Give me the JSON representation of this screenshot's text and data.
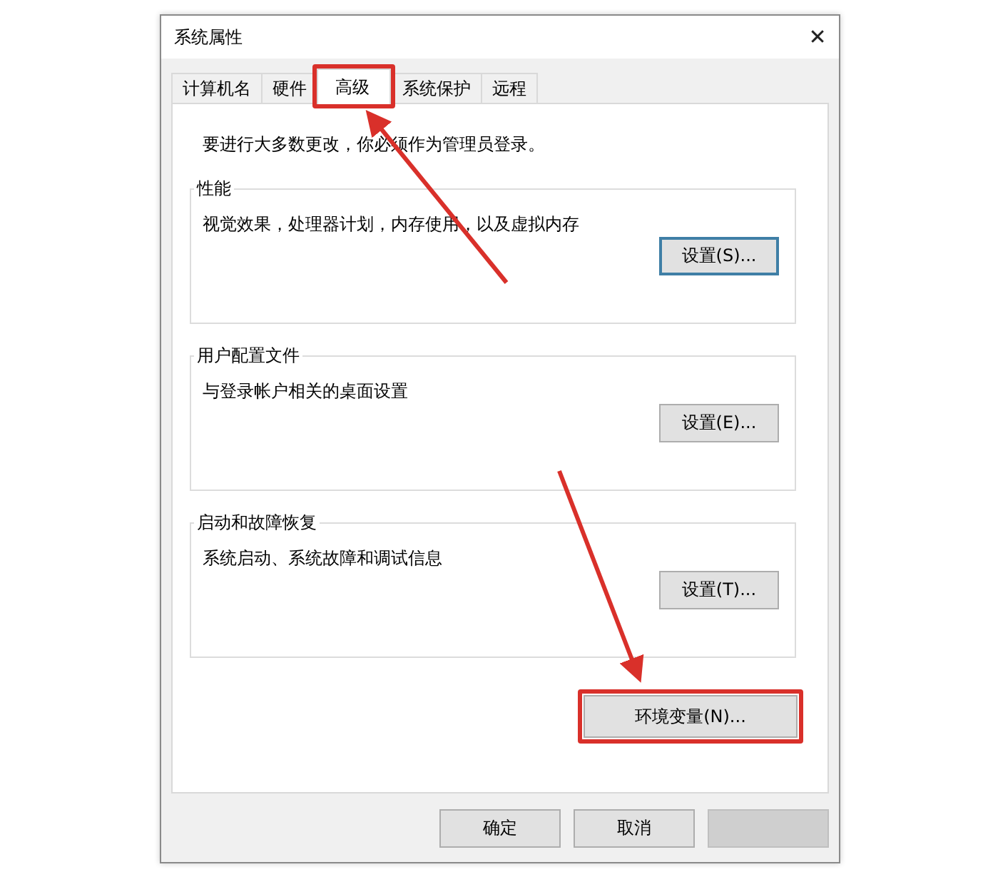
{
  "window": {
    "title": "系统属性",
    "close": "✕"
  },
  "tabs": [
    {
      "label": "计算机名",
      "selected": false
    },
    {
      "label": "硬件",
      "selected": false
    },
    {
      "label": "高级",
      "selected": true,
      "annotated": true
    },
    {
      "label": "系统保护",
      "selected": false
    },
    {
      "label": "远程",
      "selected": false
    }
  ],
  "notice": "要进行大多数更改，你必须作为管理员登录。",
  "groups": [
    {
      "heading": "性能",
      "description": "视觉效果，处理器计划，内存使用，以及虚拟内存",
      "button": {
        "label": "设置(S)...",
        "focused": true
      }
    },
    {
      "heading": "用户配置文件",
      "description": "与登录帐户相关的桌面设置",
      "button": {
        "label": "设置(E)...",
        "focused": false
      }
    },
    {
      "heading": "启动和故障恢复",
      "description": "系统启动、系统故障和调试信息",
      "button": {
        "label": "设置(T)...",
        "focused": false
      }
    }
  ],
  "environment_button": {
    "label": "环境变量(N)...",
    "annotated": true
  },
  "dialog_buttons": [
    {
      "label": "确定",
      "disabled": false
    },
    {
      "label": "取消",
      "disabled": false
    },
    {
      "disabled": true
    }
  ]
}
